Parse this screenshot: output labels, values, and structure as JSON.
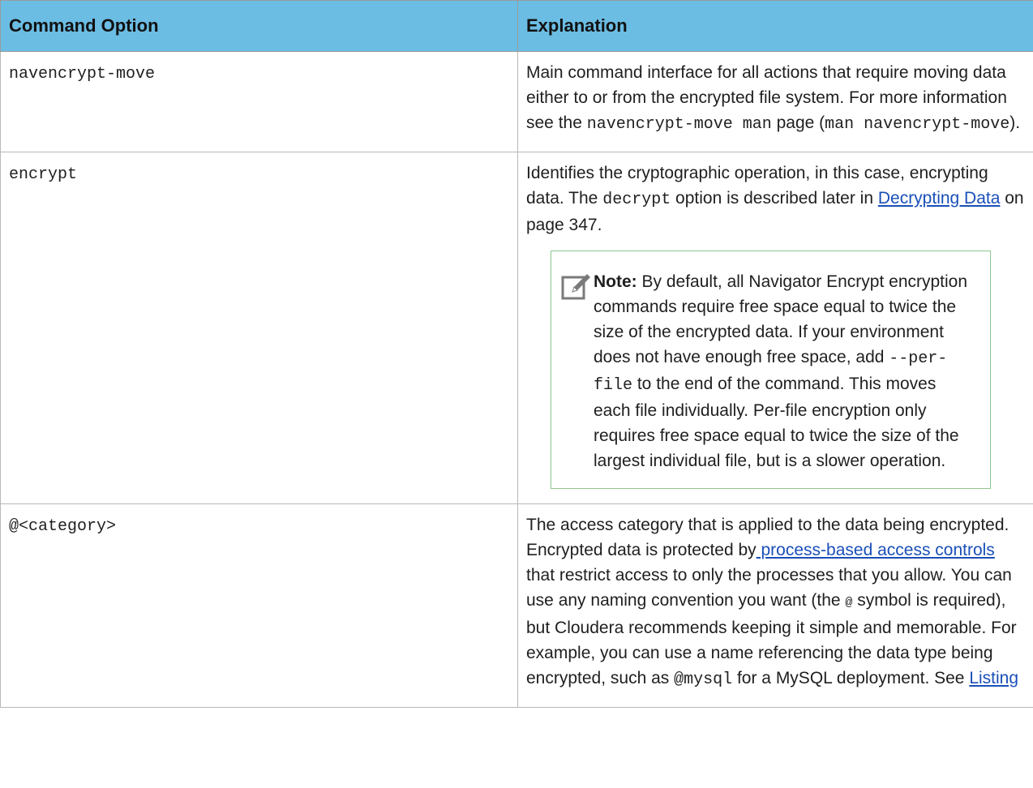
{
  "table": {
    "header": {
      "col1": "Command Option",
      "col2": "Explanation"
    },
    "rows": [
      {
        "option": "navencrypt-move",
        "exp_a": "Main command interface for all actions that require moving data either to or from the encrypted file system. For more information see the ",
        "exp_code1": "navencrypt-move man",
        "exp_b": " page (",
        "exp_code2": "man navencrypt-move",
        "exp_c": ")."
      },
      {
        "option": "encrypt",
        "exp_a": "Identifies the cryptographic operation, in this case, encrypting data. The ",
        "exp_code1": "decrypt",
        "exp_b": " option is described later in ",
        "exp_link": "Decrypting Data",
        "exp_c": " on page 347.",
        "note": {
          "icon": "note-pencil-icon",
          "label": "Note:",
          "text_a": " By default, all Navigator Encrypt encryption commands require free space equal to twice the size of the encrypted data. If your environment does not have enough free space, add ",
          "code": "--per-file",
          "text_b": " to the end of the command. This moves each file individually. Per-file encryption only requires free space equal to twice the size of the largest individual file, but is a slower operation."
        }
      },
      {
        "option": "@<category>",
        "exp_a": "The access category that is applied to the data being encrypted. Encrypted data is protected by",
        "exp_link1": " process-based access controls",
        "exp_b": " that restrict access to only the processes that you allow. You can use any naming convention you want (the ",
        "exp_code1": "@",
        "exp_c": " symbol is required), but Cloudera recommends keeping it simple and memorable. For example, you can use a name referencing the data type being encrypted, such as ",
        "exp_code2": "@mysql",
        "exp_d": " for a MySQL deployment. See ",
        "exp_link2": "Listing"
      }
    ]
  },
  "colors": {
    "header_bg": "#6bbde4",
    "link": "#1a4fb8",
    "note_border": "#8ec68e",
    "grid": "#b8b8b8"
  }
}
